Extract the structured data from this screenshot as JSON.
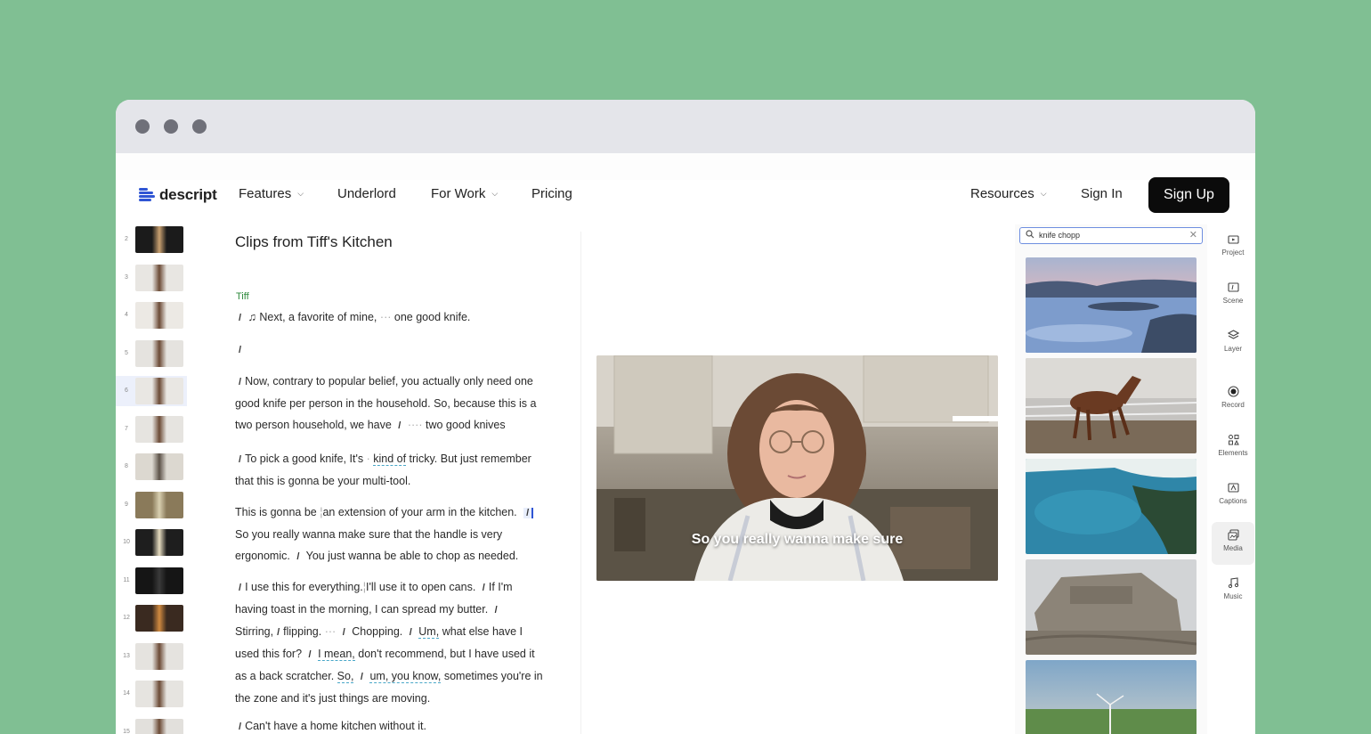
{
  "nav": {
    "logo_text": "descript",
    "features": "Features",
    "underlord": "Underlord",
    "for_work": "For Work",
    "pricing": "Pricing",
    "resources": "Resources",
    "sign_in": "Sign In",
    "sign_up": "Sign Up"
  },
  "thumbnails": [
    {
      "num": "2"
    },
    {
      "num": "3"
    },
    {
      "num": "4"
    },
    {
      "num": "5"
    },
    {
      "num": "6"
    },
    {
      "num": "7"
    },
    {
      "num": "8"
    },
    {
      "num": "9"
    },
    {
      "num": "10"
    },
    {
      "num": "11"
    },
    {
      "num": "12"
    },
    {
      "num": "13"
    },
    {
      "num": "14"
    },
    {
      "num": "15"
    }
  ],
  "transcript": {
    "title": "Clips from Tiff's Kitchen",
    "speaker": "Tiff",
    "p1_a": "Next, a favorite of mine,",
    "p1_b": "one good knife.",
    "p3_a": "Now, contrary to popular belief, you actually only need one good knife per person in the household. So, because this is a two person household, we have",
    "p3_b": "two good knives",
    "p4_a": "To pick a good knife, It's",
    "p4_b": "kind of",
    "p4_c": "tricky. But just remember that this is gonna be your multi-tool.",
    "p5_a": "This is gonna be",
    "p5_b": "an extension of your arm in the kitchen.",
    "p5_c": "So you really wanna make sure that the handle is very ergonomic.",
    "p5_d": "You just wanna be able to chop as needed.",
    "p6_a": "I use this for everything.",
    "p6_b": "I'll use it to open cans.",
    "p6_c": "If I'm having toast in the morning, I can spread my butter.",
    "p6_d": "Stirring,",
    "p6_e": "flipping.",
    "p6_f": "Chopping.",
    "p6_g": "Um,",
    "p6_h": "what else have I used this for?",
    "p6_i": "I mean,",
    "p6_j": "don't recommend, but I have used it as a back scratcher.",
    "p6_k": "So,",
    "p6_l": "um, you know,",
    "p6_m": "sometimes you're in the zone and it's just things are moving.",
    "p7_a": "Can't have a home kitchen without it."
  },
  "video": {
    "caption": "So you really wanna make sure"
  },
  "media": {
    "search_value": "knife chopp",
    "tiles": [
      "aerial-lake-video",
      "horse-video",
      "coastline-video",
      "stone-ruins-video",
      "wind-turbine-video"
    ]
  },
  "rail": {
    "items": [
      {
        "label": "Project",
        "icon": "project-icon"
      },
      {
        "label": "Scene",
        "icon": "scene-icon"
      },
      {
        "label": "Layer",
        "icon": "layer-icon"
      },
      {
        "label": "Record",
        "icon": "record-icon"
      },
      {
        "label": "Elements",
        "icon": "elements-icon"
      },
      {
        "label": "Captions",
        "icon": "captions-icon"
      },
      {
        "label": "Media",
        "icon": "media-icon"
      },
      {
        "label": "Music",
        "icon": "music-icon"
      }
    ],
    "active": "Media"
  },
  "colors": {
    "background": "#80bf93",
    "accent": "#2f55d4",
    "speaker": "#2e8a3c",
    "signup_bg": "#0b0b0b"
  }
}
